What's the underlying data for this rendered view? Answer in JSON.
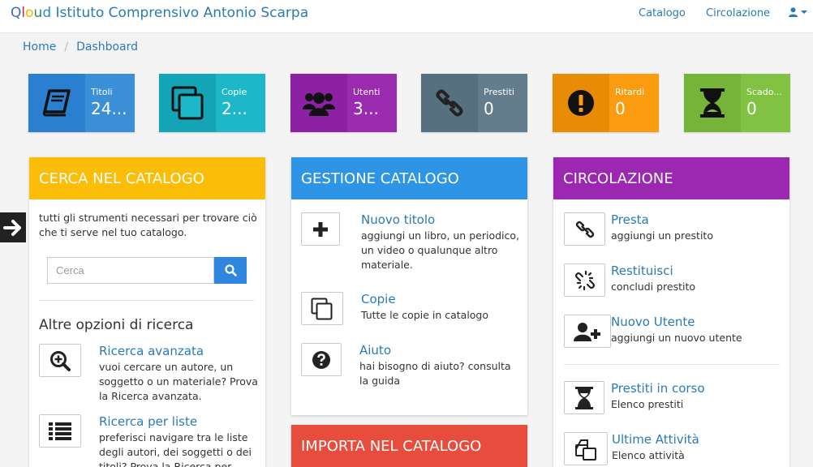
{
  "navbar": {
    "brand_q": "Q",
    "brand_l": "l",
    "brand_o": "o",
    "brand_u": "u",
    "brand_d": "d",
    "brand_rest": " Istituto Comprensivo Antonio Scarpa",
    "catalogo": "Catalogo",
    "circolazione": "Circolazione",
    "user_icon": "user-icon",
    "caret_icon": "caret-down-icon"
  },
  "breadcrumb": {
    "home": "Home",
    "sep": "/",
    "dashboard": "Dashboard"
  },
  "stats": [
    {
      "label": "Titoli",
      "value": "24...",
      "color": "#3a8fd6",
      "icon_bg": "#2a7fd0",
      "icon": "book-icon"
    },
    {
      "label": "Copie",
      "value": "2...",
      "color": "#1cb7c9",
      "icon_bg": "#13a4b6",
      "icon": "copy-icon"
    },
    {
      "label": "Utenti",
      "value": "3...",
      "color": "#9b2cb2",
      "icon_bg": "#8c22a3",
      "icon": "users-icon"
    },
    {
      "label": "Prestiti",
      "value": "0",
      "color": "#647d8c",
      "icon_bg": "#56707f",
      "icon": "link-icon"
    },
    {
      "label": "Ritardi",
      "value": "0",
      "color": "#fb9b10",
      "icon_bg": "#e88c05",
      "icon": "exclamation-icon"
    },
    {
      "label": "Scado...",
      "value": "0",
      "color": "#82c243",
      "icon_bg": "#75b438",
      "icon": "hourglass-icon"
    }
  ],
  "cerca": {
    "title": "CERCA NEL CATALOGO",
    "color": "#fbbd08",
    "desc": "tutti gli strumenti necessari per trovare ciò che ti serve nel tuo catalogo.",
    "placeholder": "Cerca",
    "subhead": "Altre opzioni di ricerca",
    "items": [
      {
        "title": "Ricerca avanzata",
        "sub": "vuoi cercare un autore, un soggetto o un materiale? Prova la Ricerca avanzata.",
        "icon": "search-plus-icon"
      },
      {
        "title": "Ricerca per liste",
        "sub": "preferisci navigare tra le liste degli autori, dei soggetti o dei titoli? Prova la Ricerca per liste.",
        "icon": "list-icon"
      }
    ]
  },
  "gestione": {
    "title": "GESTIONE CATALOGO",
    "color": "#2e95e6",
    "items": [
      {
        "title": "Nuovo titolo",
        "sub": "aggiungi un libro, un periodico, un video o qualunque altro materiale.",
        "icon": "plus-icon"
      },
      {
        "title": "Copie",
        "sub": "Tutte le copie in catalogo",
        "icon": "copy-icon"
      },
      {
        "title": "Aiuto",
        "sub": "hai bisogno di aiuto? consulta la guida",
        "icon": "question-icon"
      }
    ]
  },
  "importa": {
    "title": "IMPORTA NEL CATALOGO",
    "color": "#e84c3d"
  },
  "circolazione": {
    "title": "CIRCOLAZIONE",
    "color": "#9c27b0",
    "items": [
      {
        "title": "Presta",
        "sub": "aggiungi un prestito",
        "icon": "link-icon"
      },
      {
        "title": "Restituisci",
        "sub": "concludi prestito",
        "icon": "unlink-icon"
      },
      {
        "title": "Nuovo Utente",
        "sub": "aggiungi un nuovo utente",
        "icon": "user-plus-icon"
      },
      {
        "title": "Prestiti in corso",
        "sub": "Elenco prestiti",
        "icon": "hourglass-icon"
      },
      {
        "title": "Ultime Attività",
        "sub": "Elenco attività",
        "icon": "copy-icon"
      }
    ]
  },
  "side_toggle_icon": "arrow-right-icon"
}
